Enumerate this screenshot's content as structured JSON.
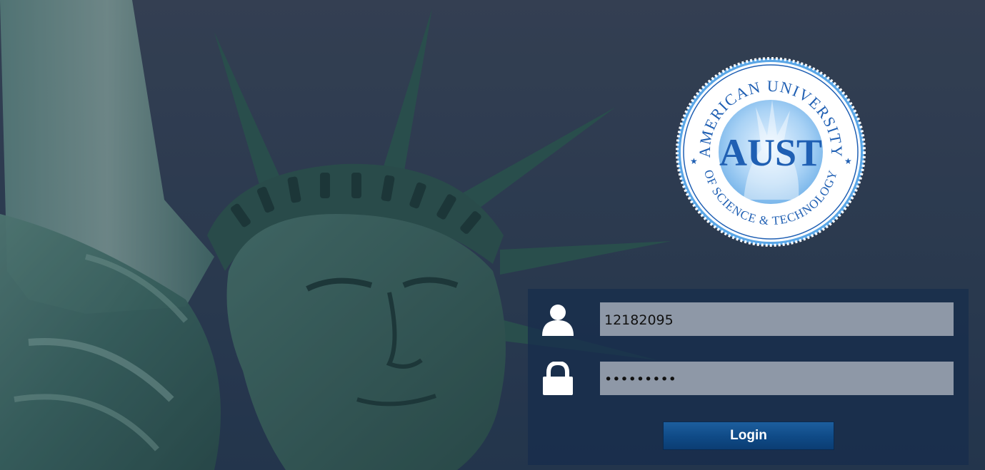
{
  "logo": {
    "top_text": "AMERICAN UNIVERSITY",
    "center_text": "AUST",
    "bottom_text": "OF SCIENCE & TECHNOLOGY"
  },
  "login_form": {
    "username_value": "12182095",
    "password_value": "•••••••••",
    "login_label": "Login"
  },
  "icons": {
    "username": "user-icon",
    "password": "lock-icon"
  },
  "colors": {
    "panel_bg": "#162c4c",
    "input_bg": "#8e98a7",
    "button_bg": "#0f4a86",
    "logo_blue": "#1f5fb3"
  }
}
